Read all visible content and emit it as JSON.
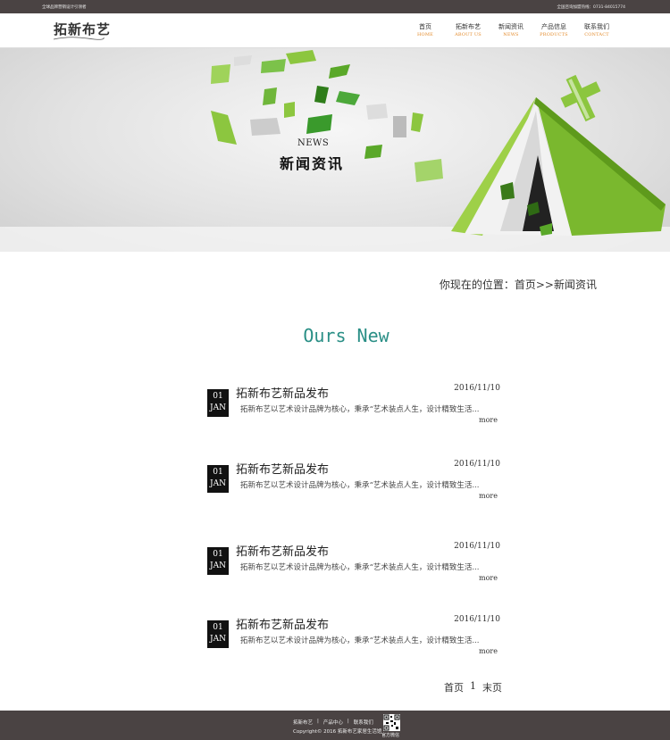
{
  "topbar": {
    "left_text": "全球品牌营销设计引领者",
    "right_text": "全国咨询加盟热线：0731-84015774"
  },
  "header": {
    "logo": "拓新布艺",
    "nav": [
      {
        "cn": "首页",
        "en": "HOME"
      },
      {
        "cn": "拓新布艺",
        "en": "ABOUT US"
      },
      {
        "cn": "新闻资讯",
        "en": "NEWS"
      },
      {
        "cn": "产品信息",
        "en": "PRODUCTS"
      },
      {
        "cn": "联系我们",
        "en": "CONTACT"
      }
    ]
  },
  "banner": {
    "title_en": "NEWS",
    "title_cn": "新闻资讯"
  },
  "breadcrumb": "你现在的位置：首页>>新闻资讯",
  "section_title": "Ours New",
  "news": [
    {
      "day": "01",
      "month": "JAN",
      "title": "拓新布艺新品发布",
      "date": "2016/11/10",
      "desc": "拓新布艺以艺术设计品牌为核心，秉承“艺术装点人生，设计精致生活...",
      "more": "more"
    },
    {
      "day": "01",
      "month": "JAN",
      "title": "拓新布艺新品发布",
      "date": "2016/11/10",
      "desc": "拓新布艺以艺术设计品牌为核心，秉承“艺术装点人生，设计精致生活...",
      "more": "more"
    },
    {
      "day": "01",
      "month": "JAN",
      "title": "拓新布艺新品发布",
      "date": "2016/11/10",
      "desc": "拓新布艺以艺术设计品牌为核心，秉承“艺术装点人生，设计精致生活...",
      "more": "more"
    },
    {
      "day": "01",
      "month": "JAN",
      "title": "拓新布艺新品发布",
      "date": "2016/11/10",
      "desc": "拓新布艺以艺术设计品牌为核心，秉承“艺术装点人生，设计精致生活...",
      "more": "more"
    }
  ],
  "pagination": {
    "first": "首页",
    "page": "1",
    "last": "末页"
  },
  "footer": {
    "links": [
      "拓新布艺",
      "|",
      "产品中心",
      "|",
      "联系我们"
    ],
    "copyright": "Copyright© 2016 拓新布艺家居生活馆",
    "qr_label": "官方微信"
  },
  "colors": {
    "accent_green": "#8cc63f",
    "title_teal": "#2a8f86",
    "nav_en": "#e38a2a",
    "dark_bar": "#4a4343"
  }
}
